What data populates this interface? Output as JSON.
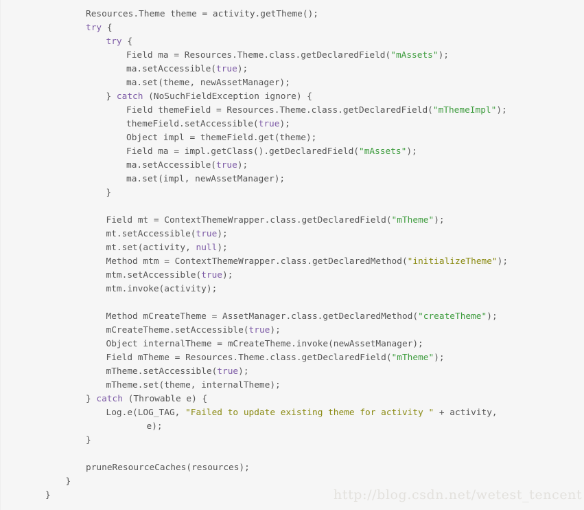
{
  "document": {
    "language": "java",
    "background_color": "#f6f6f6",
    "default_text_color": "#555555"
  },
  "colors": {
    "keyword": "#7d5ba6",
    "string_green": "#3e9c3e",
    "string_olive": "#8a8a12",
    "plain": "#555555",
    "watermark": "#e3e1dd",
    "background": "#f6f6f6"
  },
  "watermark": {
    "text": "http://blog.csdn.net/wetest_tencent"
  },
  "code": {
    "lines": [
      {
        "indent": 0,
        "tokens": [
          {
            "t": "Resources.Theme theme = activity.getTheme();",
            "c": "pln"
          }
        ]
      },
      {
        "indent": 0,
        "tokens": [
          {
            "t": "try",
            "c": "kw"
          },
          {
            "t": " {",
            "c": "pln"
          }
        ]
      },
      {
        "indent": 1,
        "tokens": [
          {
            "t": "try",
            "c": "kw"
          },
          {
            "t": " {",
            "c": "pln"
          }
        ]
      },
      {
        "indent": 2,
        "tokens": [
          {
            "t": "Field ma = Resources.Theme.class.getDeclaredField(",
            "c": "pln"
          },
          {
            "t": "\"mAssets\"",
            "c": "str"
          },
          {
            "t": ");",
            "c": "pln"
          }
        ]
      },
      {
        "indent": 2,
        "tokens": [
          {
            "t": "ma.setAccessible(",
            "c": "pln"
          },
          {
            "t": "true",
            "c": "kw"
          },
          {
            "t": ");",
            "c": "pln"
          }
        ]
      },
      {
        "indent": 2,
        "tokens": [
          {
            "t": "ma.set(theme, newAssetManager);",
            "c": "pln"
          }
        ]
      },
      {
        "indent": 1,
        "tokens": [
          {
            "t": "} ",
            "c": "pln"
          },
          {
            "t": "catch",
            "c": "kw"
          },
          {
            "t": " (NoSuchFieldException ignore) {",
            "c": "pln"
          }
        ]
      },
      {
        "indent": 2,
        "tokens": [
          {
            "t": "Field themeField = Resources.Theme.class.getDeclaredField(",
            "c": "pln"
          },
          {
            "t": "\"mThemeImpl\"",
            "c": "str"
          },
          {
            "t": ");",
            "c": "pln"
          }
        ]
      },
      {
        "indent": 2,
        "tokens": [
          {
            "t": "themeField.setAccessible(",
            "c": "pln"
          },
          {
            "t": "true",
            "c": "kw"
          },
          {
            "t": ");",
            "c": "pln"
          }
        ]
      },
      {
        "indent": 2,
        "tokens": [
          {
            "t": "Object impl = themeField.get(theme);",
            "c": "pln"
          }
        ]
      },
      {
        "indent": 2,
        "tokens": [
          {
            "t": "Field ma = impl.getClass().getDeclaredField(",
            "c": "pln"
          },
          {
            "t": "\"mAssets\"",
            "c": "str"
          },
          {
            "t": ");",
            "c": "pln"
          }
        ]
      },
      {
        "indent": 2,
        "tokens": [
          {
            "t": "ma.setAccessible(",
            "c": "pln"
          },
          {
            "t": "true",
            "c": "kw"
          },
          {
            "t": ");",
            "c": "pln"
          }
        ]
      },
      {
        "indent": 2,
        "tokens": [
          {
            "t": "ma.set(impl, newAssetManager);",
            "c": "pln"
          }
        ]
      },
      {
        "indent": 1,
        "tokens": [
          {
            "t": "}",
            "c": "pln"
          }
        ]
      },
      {
        "indent": 0,
        "tokens": [
          {
            "t": "",
            "c": "pln"
          }
        ]
      },
      {
        "indent": 1,
        "tokens": [
          {
            "t": "Field mt = ContextThemeWrapper.class.getDeclaredField(",
            "c": "pln"
          },
          {
            "t": "\"mTheme\"",
            "c": "str"
          },
          {
            "t": ");",
            "c": "pln"
          }
        ]
      },
      {
        "indent": 1,
        "tokens": [
          {
            "t": "mt.setAccessible(",
            "c": "pln"
          },
          {
            "t": "true",
            "c": "kw"
          },
          {
            "t": ");",
            "c": "pln"
          }
        ]
      },
      {
        "indent": 1,
        "tokens": [
          {
            "t": "mt.set(activity, ",
            "c": "pln"
          },
          {
            "t": "null",
            "c": "kw"
          },
          {
            "t": ");",
            "c": "pln"
          }
        ]
      },
      {
        "indent": 1,
        "tokens": [
          {
            "t": "Method mtm = ContextThemeWrapper.class.getDeclaredMethod(",
            "c": "pln"
          },
          {
            "t": "\"initializeTheme\"",
            "c": "str2"
          },
          {
            "t": ");",
            "c": "pln"
          }
        ]
      },
      {
        "indent": 1,
        "tokens": [
          {
            "t": "mtm.setAccessible(",
            "c": "pln"
          },
          {
            "t": "true",
            "c": "kw"
          },
          {
            "t": ");",
            "c": "pln"
          }
        ]
      },
      {
        "indent": 1,
        "tokens": [
          {
            "t": "mtm.invoke(activity);",
            "c": "pln"
          }
        ]
      },
      {
        "indent": 0,
        "tokens": [
          {
            "t": "",
            "c": "pln"
          }
        ]
      },
      {
        "indent": 1,
        "tokens": [
          {
            "t": "Method mCreateTheme = AssetManager.class.getDeclaredMethod(",
            "c": "pln"
          },
          {
            "t": "\"createTheme\"",
            "c": "str"
          },
          {
            "t": ");",
            "c": "pln"
          }
        ]
      },
      {
        "indent": 1,
        "tokens": [
          {
            "t": "mCreateTheme.setAccessible(",
            "c": "pln"
          },
          {
            "t": "true",
            "c": "kw"
          },
          {
            "t": ");",
            "c": "pln"
          }
        ]
      },
      {
        "indent": 1,
        "tokens": [
          {
            "t": "Object internalTheme = mCreateTheme.invoke(newAssetManager);",
            "c": "pln"
          }
        ]
      },
      {
        "indent": 1,
        "tokens": [
          {
            "t": "Field mTheme = Resources.Theme.class.getDeclaredField(",
            "c": "pln"
          },
          {
            "t": "\"mTheme\"",
            "c": "str"
          },
          {
            "t": ");",
            "c": "pln"
          }
        ]
      },
      {
        "indent": 1,
        "tokens": [
          {
            "t": "mTheme.setAccessible(",
            "c": "pln"
          },
          {
            "t": "true",
            "c": "kw"
          },
          {
            "t": ");",
            "c": "pln"
          }
        ]
      },
      {
        "indent": 1,
        "tokens": [
          {
            "t": "mTheme.set(theme, internalTheme);",
            "c": "pln"
          }
        ]
      },
      {
        "indent": 0,
        "tokens": [
          {
            "t": "} ",
            "c": "pln"
          },
          {
            "t": "catch",
            "c": "kw"
          },
          {
            "t": " (Throwable e) {",
            "c": "pln"
          }
        ]
      },
      {
        "indent": 1,
        "tokens": [
          {
            "t": "Log.e(LOG_TAG, ",
            "c": "pln"
          },
          {
            "t": "\"Failed to update existing theme for activity \"",
            "c": "str2"
          },
          {
            "t": " + activity,",
            "c": "pln"
          }
        ]
      },
      {
        "indent": 3,
        "tokens": [
          {
            "t": "e);",
            "c": "pln"
          }
        ]
      },
      {
        "indent": 0,
        "tokens": [
          {
            "t": "}",
            "c": "pln"
          }
        ]
      },
      {
        "indent": 0,
        "tokens": [
          {
            "t": "",
            "c": "pln"
          }
        ]
      },
      {
        "indent": 0,
        "tokens": [
          {
            "t": "pruneResourceCaches(resources);",
            "c": "pln"
          }
        ]
      },
      {
        "indent": -1,
        "tokens": [
          {
            "t": "}",
            "c": "pln"
          }
        ]
      },
      {
        "indent": -2,
        "tokens": [
          {
            "t": "}",
            "c": "pln"
          }
        ]
      }
    ]
  }
}
